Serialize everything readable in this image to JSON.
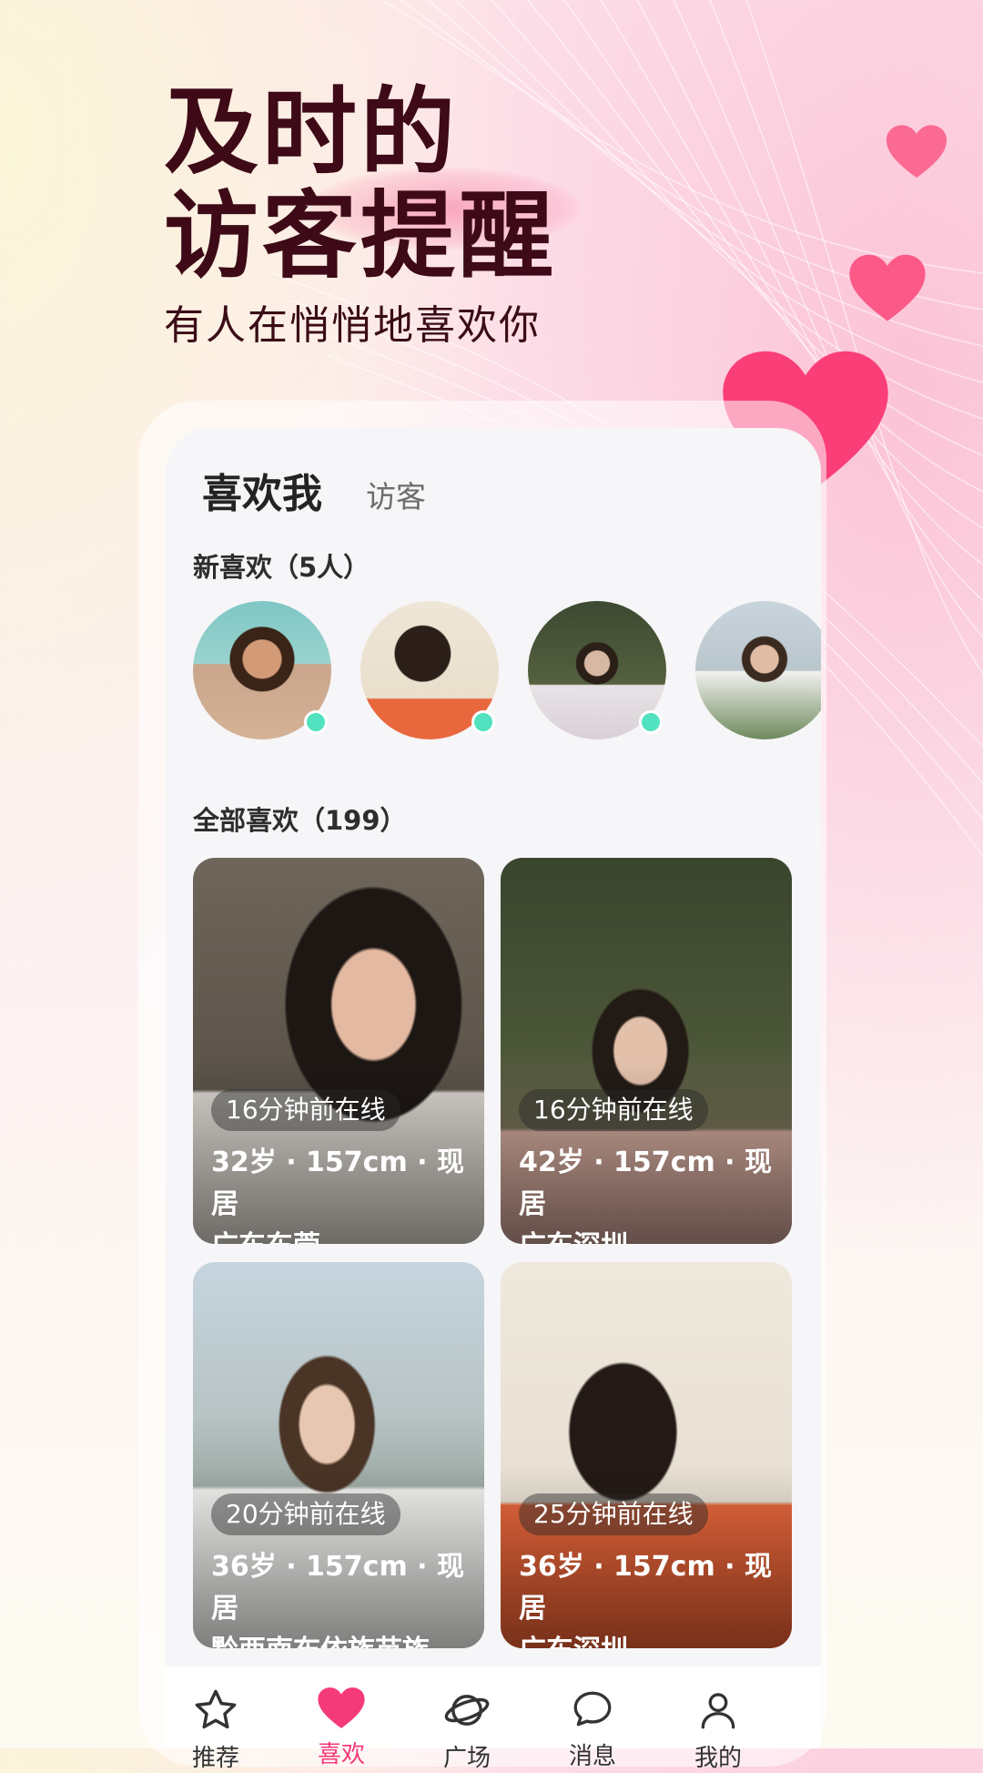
{
  "hero": {
    "line1": "及时的",
    "line2": "访客提醒",
    "subtitle": "有人在悄悄地喜欢你"
  },
  "tabs": {
    "active": "喜欢我",
    "other": "访客"
  },
  "new_likes": {
    "title": "新喜欢（5人）"
  },
  "all_likes": {
    "title": "全部喜欢（199）",
    "cards": [
      {
        "online": "16分钟前在线",
        "line1": "32岁 · 157cm · 现居",
        "line2": "广东东莞"
      },
      {
        "online": "16分钟前在线",
        "line1": "42岁 · 157cm · 现居",
        "line2": "广东深圳"
      },
      {
        "online": "20分钟前在线",
        "line1": "36岁 · 157cm · 现居",
        "line2": "黔西南布依族苗族"
      },
      {
        "online": "25分钟前在线",
        "line1": "36岁 · 157cm · 现居",
        "line2": "广东深圳"
      }
    ]
  },
  "nav": {
    "items": [
      {
        "label": "推荐",
        "icon": "star-icon"
      },
      {
        "label": "喜欢",
        "icon": "heart-icon"
      },
      {
        "label": "广场",
        "icon": "planet-icon"
      },
      {
        "label": "消息",
        "icon": "chat-bubble-icon"
      },
      {
        "label": "我的",
        "icon": "person-icon"
      }
    ]
  },
  "colors": {
    "accent": "#f53a79",
    "online_dot": "#53e2bf",
    "title": "#3e0a17"
  }
}
